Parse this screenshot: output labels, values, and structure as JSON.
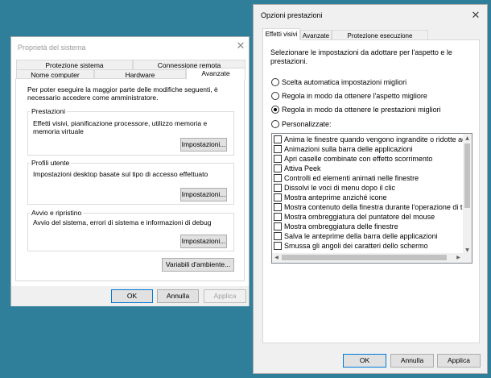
{
  "sys_window": {
    "title": "Proprietà del sistema",
    "tabs_row1": [
      "Protezione sistema",
      "Connessione remota"
    ],
    "tabs_row2": [
      "Nome computer",
      "Hardware",
      "Avanzate"
    ],
    "active_tab": "Avanzate",
    "intro": "Per poter eseguire la maggior parte delle modifiche seguenti, è necessario accedere come amministratore.",
    "groups": [
      {
        "label": "Prestazioni",
        "text": "Effetti visivi, pianificazione processore, utilizzo memoria e memoria virtuale",
        "button": "Impostazioni..."
      },
      {
        "label": "Profili utente",
        "text": "Impostazioni desktop basate sul tipo di accesso effettuato",
        "button": "Impostazioni..."
      },
      {
        "label": "Avvio e ripristino",
        "text": "Avvio del sistema, errori di sistema e informazioni di debug",
        "button": "Impostazioni..."
      }
    ],
    "env_button": "Variabili d'ambiente...",
    "footer": {
      "ok": "OK",
      "cancel": "Annulla",
      "apply": "Applica"
    }
  },
  "perf_window": {
    "title": "Opzioni prestazioni",
    "tabs": [
      "Effetti visivi",
      "Avanzate",
      "Protezione esecuzione programmi"
    ],
    "active_tab": "Effetti visivi",
    "intro": "Selezionare le impostazioni da adottare per l'aspetto e le prestazioni.",
    "radios": [
      {
        "label": "Scelta automatica impostazioni migliori",
        "checked": false
      },
      {
        "label": "Regola in modo da ottenere l'aspetto migliore",
        "checked": false
      },
      {
        "label": "Regola in modo da ottenere le prestazioni migliori",
        "checked": true
      },
      {
        "label": "Personalizzate:",
        "checked": false
      }
    ],
    "checkboxes": [
      "Anima le finestre quando vengono ingrandite o ridotte ad icona",
      "Animazioni sulla barra delle applicazioni",
      "Apri caselle combinate con effetto scorrimento",
      "Attiva Peek",
      "Controlli ed elementi animati nelle finestre",
      "Dissolvi le voci di menu dopo il clic",
      "Mostra anteprime anziché icone",
      "Mostra contenuto della finestra durante l'operazione di trascinamento",
      "Mostra ombreggiatura del puntatore del mouse",
      "Mostra ombreggiatura delle finestre",
      "Salva le anteprime della barra delle applicazioni",
      "Smussa gli angoli dei caratteri dello schermo"
    ],
    "footer": {
      "ok": "OK",
      "cancel": "Annulla",
      "apply": "Applica"
    }
  }
}
